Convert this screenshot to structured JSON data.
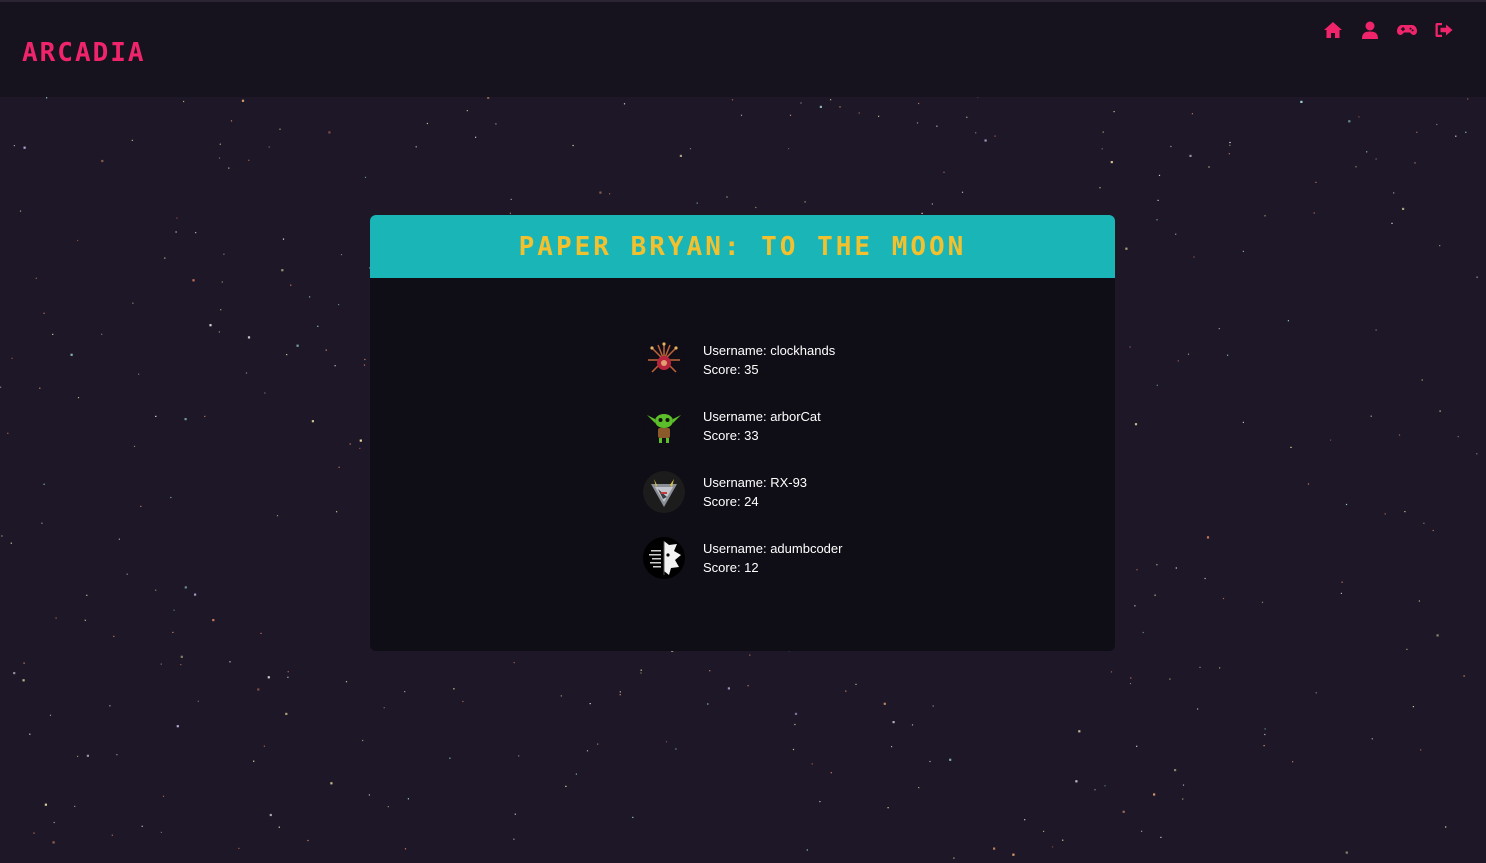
{
  "app": {
    "brand": "ARCADIA"
  },
  "nav": {
    "icons": [
      "home-icon",
      "user-icon",
      "gamepad-icon",
      "logout-icon"
    ]
  },
  "game": {
    "title": "PAPER BRYAN: TO THE MOON"
  },
  "scores": [
    {
      "username_label": "Username: clockhands",
      "score_label": "Score: 35",
      "avatar": "clockhands-avatar"
    },
    {
      "username_label": "Username: arborCat",
      "score_label": "Score: 33",
      "avatar": "goblin-avatar"
    },
    {
      "username_label": "Username: RX-93",
      "score_label": "Score: 24",
      "avatar": "mech-avatar"
    },
    {
      "username_label": "Username: adumbcoder",
      "score_label": "Score: 12",
      "avatar": "split-face-avatar"
    }
  ],
  "colors": {
    "background": "#1d1727",
    "navbar": "#16121e",
    "accent_pink": "#f0246b",
    "header_teal": "#1ab5b6",
    "title_yellow": "#f3c02e",
    "card": "#0f0d15"
  }
}
